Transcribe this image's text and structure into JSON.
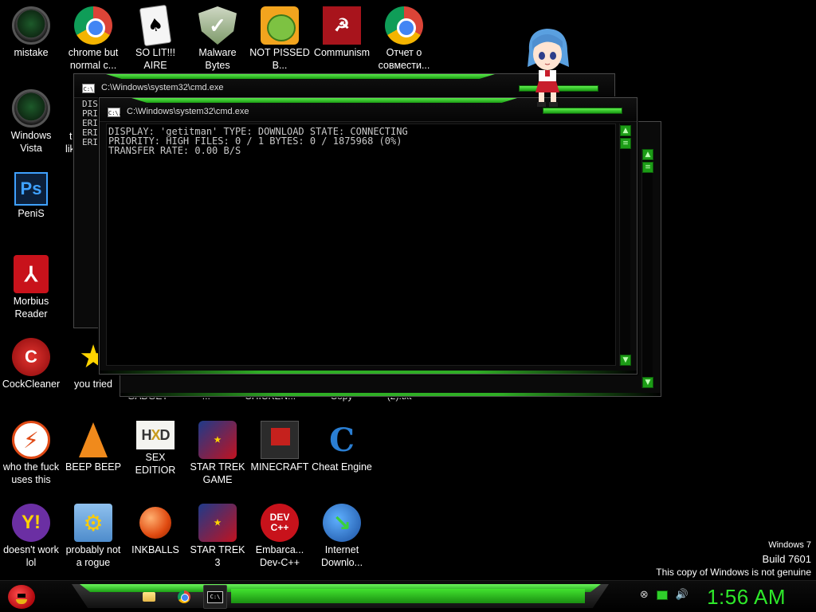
{
  "desktop_icons": [
    {
      "label": "mistake",
      "icon": "green-orb-icon"
    },
    {
      "label": "chrome but normal c...",
      "icon": "chrome-icon"
    },
    {
      "label": "SO LIT!!! AIRE",
      "icon": "playing-card-icon"
    },
    {
      "label": "Malware Bytes",
      "icon": "shield-check-icon"
    },
    {
      "label": "NOT PISSED B...",
      "icon": "angry-birds-pig-icon"
    },
    {
      "label": "Communism",
      "icon": "red-emblem-icon"
    },
    {
      "label": "Отчет о совмести...",
      "icon": "chrome-icon"
    },
    {
      "label": "Windows Vista",
      "icon": "green-orb-icon"
    },
    {
      "label": "PeniS",
      "icon": "photoshop-icon"
    },
    {
      "label": "Morbius Reader",
      "icon": "pdf-reader-icon"
    },
    {
      "label": "CockCleaner",
      "icon": "ccleaner-icon"
    },
    {
      "label": "you tried",
      "icon": "star-icon"
    },
    {
      "label": "who the fuck uses this",
      "icon": "avast-icon"
    },
    {
      "label": "BEEP BEEP",
      "icon": "vlc-cone-icon"
    },
    {
      "label": "SEX EDITIOR",
      "icon": "hxd-icon"
    },
    {
      "label": "STAR TREK GAME",
      "icon": "star-wars-game-icon"
    },
    {
      "label": "MINECRAFT",
      "icon": "minecraft-icon"
    },
    {
      "label": "Cheat Engine",
      "icon": "cheat-engine-icon"
    },
    {
      "label": "doesn't work lol",
      "icon": "yahoo-messenger-icon"
    },
    {
      "label": "probably not a rogue",
      "icon": "monitor-gear-icon"
    },
    {
      "label": "INKBALLS",
      "icon": "inkball-icon"
    },
    {
      "label": "STAR TREK 3",
      "icon": "star-wars-game-icon"
    },
    {
      "label": "Embarca... Dev-C++",
      "icon": "devcpp-icon"
    },
    {
      "label": "Internet Downlo...",
      "icon": "idm-icon"
    }
  ],
  "hidden_labels": {
    "partial_1": "t",
    "partial_2": "lik",
    "under_window": "GADGET ... CHICKEN... Copy (2).txt"
  },
  "back_window": {
    "title": "C:\\Windows\\system32\\cmd.exe",
    "visible_lines": [
      "DIS",
      "PRI",
      "ERI",
      "ERI",
      "ERI"
    ]
  },
  "front_window": {
    "title": "C:\\Windows\\system32\\cmd.exe",
    "icon_text": "C:\\.",
    "lines": [
      "DISPLAY: 'getitman' TYPE: DOWNLOAD STATE: CONNECTING",
      "PRIORITY: HIGH FILES: 0 / 1 BYTES: 0 / 1875968 (0%)",
      "TRANSFER RATE: 0.00 B/S"
    ]
  },
  "watermark": {
    "line1": "Windows 7",
    "line2": "Build 7601",
    "line3": "This copy of Windows is not genuine"
  },
  "taskbar": {
    "clock": "1:56 AM",
    "tray_icons": [
      "back-arrow-icon",
      "network-icon",
      "speaker-icon"
    ],
    "pinned": [
      "folder-icon",
      "chrome-icon",
      "cmd-icon"
    ]
  },
  "colors": {
    "accent_green": "#2ee82a",
    "background": "#000000"
  }
}
